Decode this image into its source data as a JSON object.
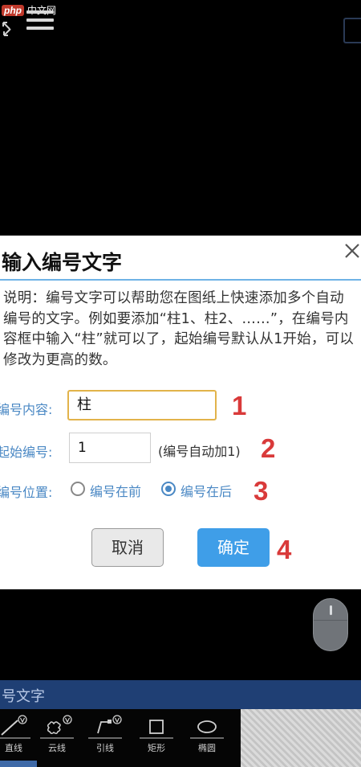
{
  "watermark": {
    "logo": "php",
    "text": "中文网"
  },
  "dialog": {
    "title": "输入编号文字",
    "description": "说明：编号文字可以帮助您在图纸上快速添加多个自动编号的文字。例如要添加“柱1、柱2、……”，在编号内容框中输入“柱”就可以了，起始编号默认从1开始，可以修改为更高的数。",
    "content_label": "编号内容:",
    "content_value": "柱",
    "start_label": "起始编号:",
    "start_value": "1",
    "start_hint": "(编号自动加1)",
    "position_label": "编号位置:",
    "position_options": [
      {
        "label": "编号在前",
        "selected": false
      },
      {
        "label": "编号在后",
        "selected": true
      }
    ],
    "cancel_label": "取消",
    "ok_label": "确定"
  },
  "annotations": [
    "1",
    "2",
    "3",
    "4"
  ],
  "bottom_panel": {
    "label": "号文字"
  },
  "toolbar": {
    "items": [
      {
        "label": "直线",
        "icon": "line-icon"
      },
      {
        "label": "云线",
        "icon": "cloud-line-icon"
      },
      {
        "label": "引线",
        "icon": "leader-line-icon"
      },
      {
        "label": "矩形",
        "icon": "rectangle-icon"
      },
      {
        "label": "椭圆",
        "icon": "ellipse-icon"
      }
    ]
  },
  "colors": {
    "accent": "#3f9ee8",
    "label_blue": "#4a88c4",
    "annotation_red": "#d93a3a",
    "focus_border": "#e2b34a"
  }
}
